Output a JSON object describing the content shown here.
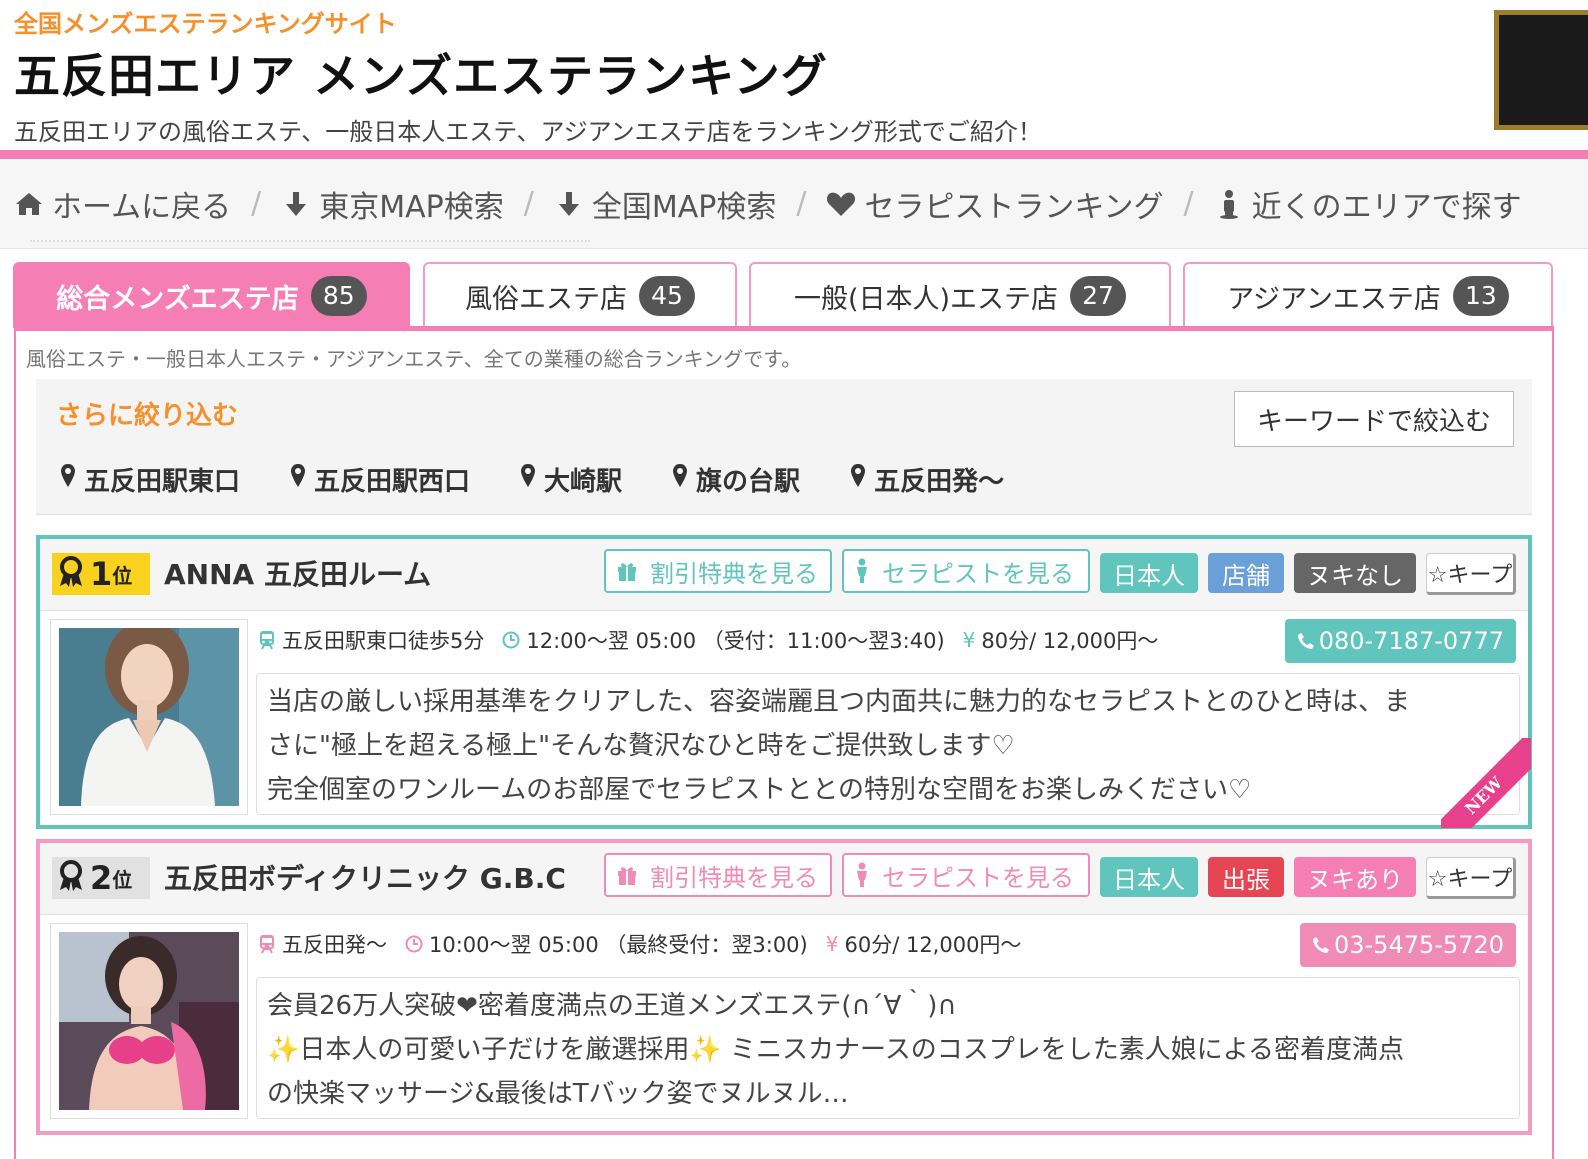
{
  "header": {
    "site_label": "全国メンズエステランキングサイト",
    "title": "五反田エリア メンズエステランキング",
    "lead": "五反田エリアの風俗エステ、一般日本人エステ、アジアンエステ店をランキング形式でご紹介！"
  },
  "nav": {
    "home": "ホームに戻る",
    "tokyo_map": "東京MAP検索",
    "national_map": "全国MAP検索",
    "therapist_ranking": "セラピストランキング",
    "nearby": "近くのエリアで探す",
    "separator": "/"
  },
  "tabs": [
    {
      "label": "総合メンズエステ店",
      "count": "85"
    },
    {
      "label": "風俗エステ店",
      "count": "45"
    },
    {
      "label": "一般(日本人)エステ店",
      "count": "27"
    },
    {
      "label": "アジアンエステ店",
      "count": "13"
    }
  ],
  "panel": {
    "description": "風俗エステ・一般日本人エステ・アジアンエステ、全ての業種の総合ランキングです。"
  },
  "filter": {
    "title": "さらに絞り込む",
    "keyword_button": "キーワードで絞込む",
    "areas": [
      "五反田駅東口",
      "五反田駅西口",
      "大崎駅",
      "旗の台駅",
      "五反田発～"
    ]
  },
  "shops": [
    {
      "rank": "1",
      "rank_suffix": "位",
      "name": "ANNA 五反田ルーム",
      "discount_button": "割引特典を見る",
      "therapist_button": "セラピストを見る",
      "badges": [
        "日本人",
        "店舗",
        "ヌキなし"
      ],
      "keep_label": "☆キープ",
      "access": "五反田駅東口徒歩5分",
      "hours": "12:00～翌 05:00 （受付：11:00～翌3:40)",
      "price": "80分/ 12,000円～",
      "tel": "080-7187-0777",
      "desc_lines": [
        "当店の厳しい採用基準をクリアした、容姿端麗且つ内面共に魅力的なセラピストとのひと時は、ま",
        "さに\"極上を超える極上\"そんな贅沢なひと時をご提供致します♡",
        "完全個室のワンルームのお部屋でセラピストととの特別な空間をお楽しみください♡"
      ],
      "new_label": "NEW"
    },
    {
      "rank": "2",
      "rank_suffix": "位",
      "name": "五反田ボディクリニック G.B.C",
      "discount_button": "割引特典を見る",
      "therapist_button": "セラピストを見る",
      "badges": [
        "日本人",
        "出張",
        "ヌキあり"
      ],
      "keep_label": "☆キープ",
      "access": "五反田発～",
      "hours": "10:00～翌 05:00 （最終受付：翌3:00)",
      "price": "60分/ 12,000円～",
      "tel": "03-5475-5720",
      "desc_lines": [
        "会員26万人突破❤密着度満点の王道メンズエステ(∩´∀｀)∩",
        "日本人の可愛い子だけを厳選採用",
        "ミニスカナースのコスプレをした素人娘による密着度満点",
        "の快楽マッサージ&最後はTバック姿でヌルヌル…"
      ],
      "sparkle": "✨"
    }
  ],
  "colors": {
    "pink": "#f57fb4",
    "orange": "#f5902a",
    "teal": "#5fc5bd",
    "blue": "#6a9fd8",
    "gray": "#666666",
    "red": "#e64553",
    "pink_badge": "#f57fb4",
    "gold": "#f8d21e"
  }
}
